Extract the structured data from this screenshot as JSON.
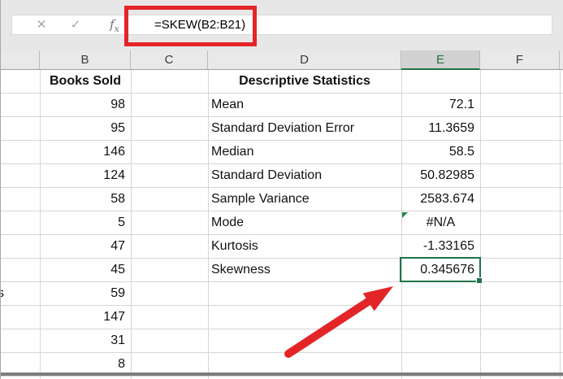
{
  "formula_bar": {
    "cancel_icon": "✕",
    "confirm_icon": "✓",
    "fx_label": "f",
    "fx_sub": "x",
    "formula": "=SKEW(B2:B21)"
  },
  "colors": {
    "accent_green": "#217346",
    "annotation_red": "#e42527",
    "error_indicator_green": "#21864e",
    "selected_header_bg": "#d2d2d2",
    "header_bg": "#e9e9e9",
    "gridline": "#d6d6d6"
  },
  "sheet": {
    "column_headers": {
      "b": "B",
      "c": "C",
      "d": "D",
      "e": "E",
      "f": "F"
    },
    "selected_column": "E",
    "b_title": "Books Sold",
    "d_title": "Descriptive Statistics",
    "partial_a_text": "s",
    "books_sold_values": [
      "98",
      "95",
      "146",
      "124",
      "58",
      "5",
      "47",
      "45",
      "59",
      "147",
      "31",
      "8"
    ],
    "statistics": [
      {
        "label": "Mean",
        "value": "72.1"
      },
      {
        "label": "Standard Deviation Error",
        "value": "11.3659"
      },
      {
        "label": "Median",
        "value": "58.5"
      },
      {
        "label": "Standard Deviation",
        "value": "50.82985"
      },
      {
        "label": "Sample Variance",
        "value": "2583.674"
      },
      {
        "label": "Mode",
        "value": "#N/A"
      },
      {
        "label": "Kurtosis",
        "value": "-1.33165"
      },
      {
        "label": "Skewness",
        "value": "0.345676"
      }
    ],
    "selected_cell_value": "0.345676"
  }
}
